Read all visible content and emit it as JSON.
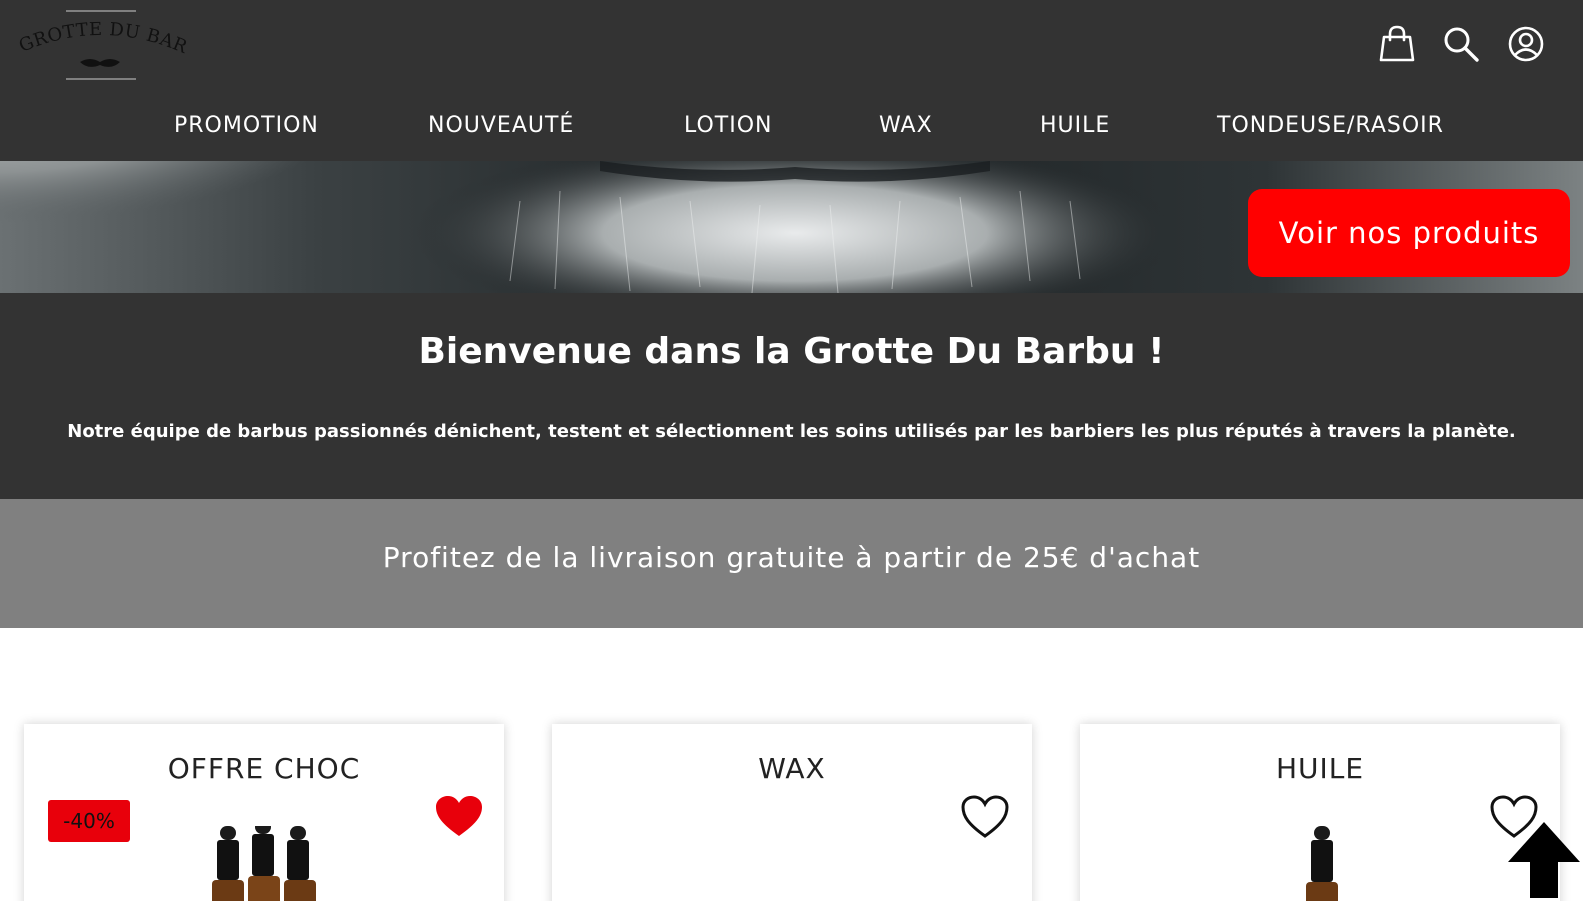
{
  "brand": {
    "logo_text": "LA GROTTE DU BARBU"
  },
  "header": {
    "icons": [
      "shopping-bag-icon",
      "search-icon",
      "user-account-icon"
    ]
  },
  "nav": {
    "items": [
      {
        "label": "PROMOTION"
      },
      {
        "label": "NOUVEAUTÉ"
      },
      {
        "label": "LOTION"
      },
      {
        "label": "WAX"
      },
      {
        "label": "HUILE"
      },
      {
        "label": "TONDEUSE/RASOIR"
      }
    ]
  },
  "hero": {
    "cta_label": "Voir nos produits"
  },
  "welcome": {
    "title": "Bienvenue dans la Grotte Du Barbu !",
    "text": "Notre équipe de barbus passionnés dénichent, testent et sélectionnent les soins utilisés par les barbiers les plus réputés à travers la planète."
  },
  "promo": {
    "text": "Profitez de la livraison gratuite à partir de 25€ d'achat"
  },
  "cards": [
    {
      "title": "OFFRE CHOC",
      "badge": "-40%",
      "favorite": true
    },
    {
      "title": "WAX",
      "favorite": false
    },
    {
      "title": "HUILE",
      "favorite": false
    }
  ],
  "colors": {
    "dark": "#333333",
    "grey": "#808080",
    "accent_red": "#ff0000",
    "white": "#ffffff"
  }
}
